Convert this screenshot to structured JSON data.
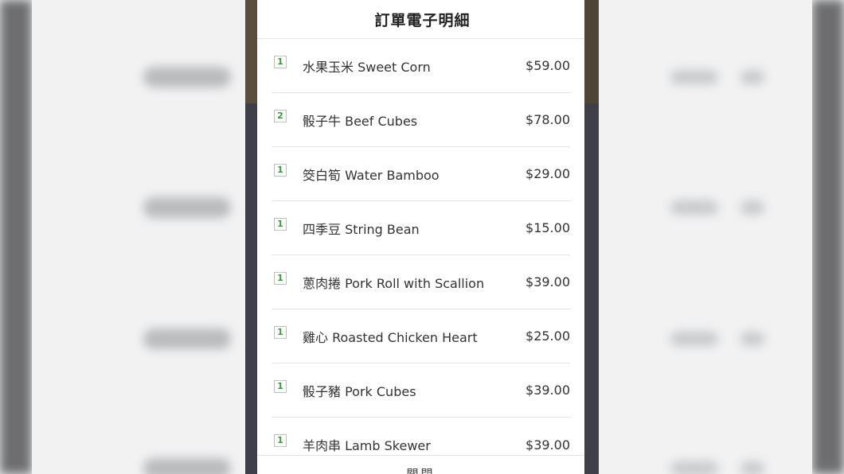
{
  "modal": {
    "title": "訂單電子明細",
    "close_label": "關閉"
  },
  "items": [
    {
      "qty": "1",
      "name": "水果玉米 Sweet Corn",
      "price": "$59.00"
    },
    {
      "qty": "2",
      "name": "骰子牛 Beef Cubes",
      "price": "$78.00"
    },
    {
      "qty": "1",
      "name": "筊白筍 Water Bamboo",
      "price": "$29.00"
    },
    {
      "qty": "1",
      "name": "四季豆 String Bean",
      "price": "$15.00"
    },
    {
      "qty": "1",
      "name": "蔥肉捲 Pork Roll with Scallion",
      "price": "$39.00"
    },
    {
      "qty": "1",
      "name": "雞心 Roasted Chicken Heart",
      "price": "$25.00"
    },
    {
      "qty": "1",
      "name": "骰子豬 Pork Cubes",
      "price": "$39.00"
    },
    {
      "qty": "1",
      "name": "羊肉串 Lamb Skewer",
      "price": "$39.00"
    }
  ],
  "colors": {
    "qty_text": "#3a9a3a",
    "backdrop_dark": "#3f3f49",
    "modal_bg": "#ffffff"
  }
}
